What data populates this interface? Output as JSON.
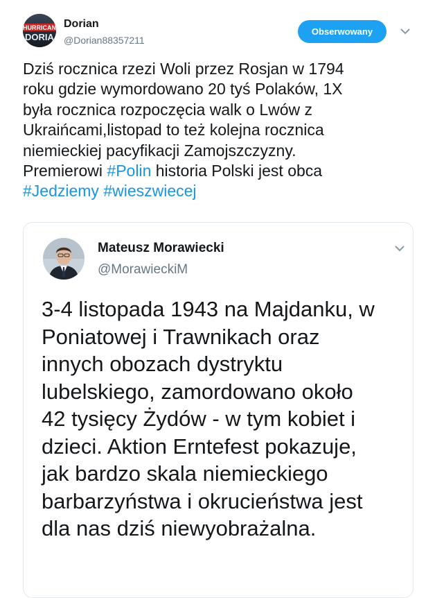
{
  "tweet": {
    "author": {
      "name": "Dorian",
      "handle": "@Dorian88357211",
      "avatar_text": "HURRICANE DORIAN",
      "avatar_line1": "HURRICAN",
      "avatar_line2": "DORIA"
    },
    "follow_button_label": "Obserwowany",
    "menu_icon": "chevron-down-icon",
    "text_lines": [
      "Dziś rocznica rzezi Woli przez Rosjan w 1794",
      "roku gdzie wymordowano 20 tyś Polaków, 1X",
      "była rocznica rozpoczęcia walk o Lwów z",
      "Ukraińcami,listopad to też kolejna rocznica",
      "niemieckiej pacyfikacji Zamojszczyzny."
    ],
    "line6_prefix": "Premierowi ",
    "hashtag_polin": "#Polin",
    "line6_suffix": "  historia Polski jest obca",
    "hashtag_jedziemy": "#Jedziemy",
    "hashtag_wieszwiecej": "#wieszwiecej"
  },
  "quoted_tweet": {
    "author": {
      "name": "Mateusz Morawiecki",
      "handle": "@MorawieckiM"
    },
    "menu_icon": "chevron-down-icon",
    "text": "3-4 listopada 1943 na Majdanku, w\nPoniatowej i Trawnikach oraz\ninnych obozach dystryktu\nlubelskiego, zamordowano około\n42 tysięcy Żydów - w tym kobiet i\ndzieci. Aktion Erntefest pokazuje,\njak bardzo skala niemieckiego\nbarbarzyństwa i okrucieństwa jest\ndla nas dziś niewyobrażalna."
  },
  "colors": {
    "accent": "#1da1f2",
    "hashtag": "#1b95e0",
    "text": "#14171a",
    "secondary": "#657786",
    "border": "#e1e8ed"
  }
}
